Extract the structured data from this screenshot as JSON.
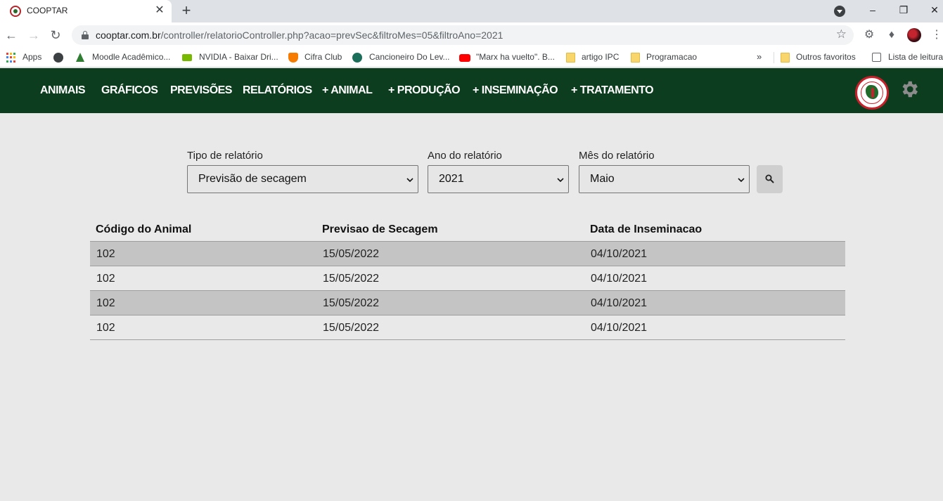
{
  "browser": {
    "tab_title": "COOPTAR",
    "tab_close": "✕",
    "new_tab": "+",
    "url_host": "cooptar.com.br",
    "url_path": "/controller/relatorioController.php?acao=prevSec&filtroMes=05&filtroAno=2021",
    "bookmarks": [
      {
        "label": "Apps",
        "icon": "apps-grid-icon"
      },
      {
        "label": "",
        "icon": "globe-icon"
      },
      {
        "label": "Moodle Acadêmico...",
        "icon": "moodle-icon"
      },
      {
        "label": "NVIDIA - Baixar Dri...",
        "icon": "nvidia-icon"
      },
      {
        "label": "Cifra Club",
        "icon": "cifraclub-icon"
      },
      {
        "label": "Cancioneiro Do Lev...",
        "icon": "cancioneiro-icon"
      },
      {
        "label": "\"Marx ha vuelto\". B...",
        "icon": "youtube-icon"
      },
      {
        "label": "artigo IPC",
        "icon": "folder-icon"
      },
      {
        "label": "Programacao",
        "icon": "folder-icon"
      }
    ],
    "overflow": "»",
    "other_bookmarks": "Outros favoritos",
    "reading_list": "Lista de leitura"
  },
  "nav": {
    "items": [
      "ANIMAIS",
      "GRÁFICOS",
      "PREVISÕES",
      "RELATÓRIOS",
      "+ ANIMAL",
      "+ PRODUÇÃO",
      "+ INSEMINAÇÃO",
      "+ TRATAMENTO"
    ]
  },
  "filters": {
    "tipo": {
      "label": "Tipo de relatório",
      "value": "Previsão de secagem"
    },
    "ano": {
      "label": "Ano do relatório",
      "value": "2021"
    },
    "mes": {
      "label": "Mês do relatório",
      "value": "Maio"
    }
  },
  "table": {
    "headers": [
      "Código do Animal",
      "Previsao de Secagem",
      "Data de Inseminacao"
    ],
    "rows": [
      [
        "102",
        "15/05/2022",
        "04/10/2021"
      ],
      [
        "102",
        "15/05/2022",
        "04/10/2021"
      ],
      [
        "102",
        "15/05/2022",
        "04/10/2021"
      ],
      [
        "102",
        "15/05/2022",
        "04/10/2021"
      ]
    ]
  }
}
